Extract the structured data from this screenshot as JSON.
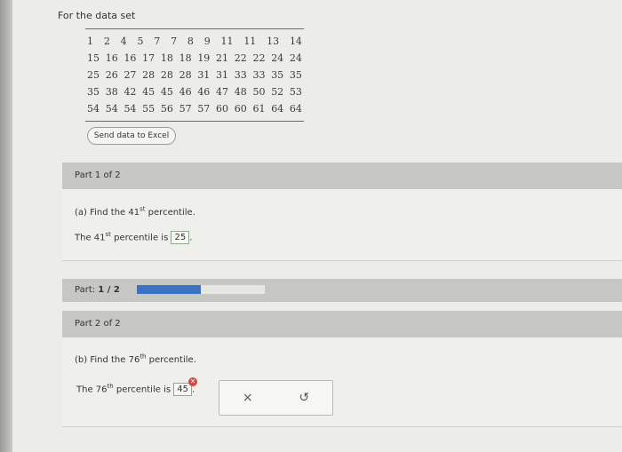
{
  "intro": "For the data set",
  "data_rows": [
    [
      "1",
      "2",
      "4",
      "5",
      "7",
      "7",
      "8",
      "9",
      "11",
      "11",
      "13",
      "14"
    ],
    [
      "15",
      "16",
      "16",
      "17",
      "18",
      "18",
      "19",
      "21",
      "22",
      "22",
      "24",
      "24"
    ],
    [
      "25",
      "26",
      "27",
      "28",
      "28",
      "28",
      "31",
      "31",
      "33",
      "33",
      "35",
      "35"
    ],
    [
      "35",
      "38",
      "42",
      "45",
      "45",
      "46",
      "46",
      "47",
      "48",
      "50",
      "52",
      "53"
    ],
    [
      "54",
      "54",
      "54",
      "55",
      "56",
      "57",
      "57",
      "60",
      "60",
      "61",
      "64",
      "64"
    ]
  ],
  "excel_button": "Send data to Excel",
  "part1": {
    "header": "Part 1 of 2",
    "question_prefix": "(a) Find the 41",
    "question_sup": "st",
    "question_suffix": " percentile.",
    "answer_prefix": "The 41",
    "answer_sup": "st",
    "answer_mid": " percentile is ",
    "answer_value": "25",
    "answer_end": "."
  },
  "progress": {
    "label": "Part: ",
    "label_bold": "1 / 2",
    "fraction": 0.5,
    "fill_color": "#3b73c4"
  },
  "part2": {
    "header": "Part 2 of 2",
    "question_prefix": "(b) Find the 76",
    "question_sup": "th",
    "question_suffix": " percentile.",
    "answer_prefix": "The 76",
    "answer_sup": "th",
    "answer_mid": " percentile is ",
    "answer_value": "45",
    "answer_end": "."
  },
  "actions": {
    "clear_icon": "×",
    "undo_icon": "↺"
  },
  "icons": {
    "error": "error-x-icon",
    "clear": "x-icon",
    "undo": "undo-icon"
  }
}
